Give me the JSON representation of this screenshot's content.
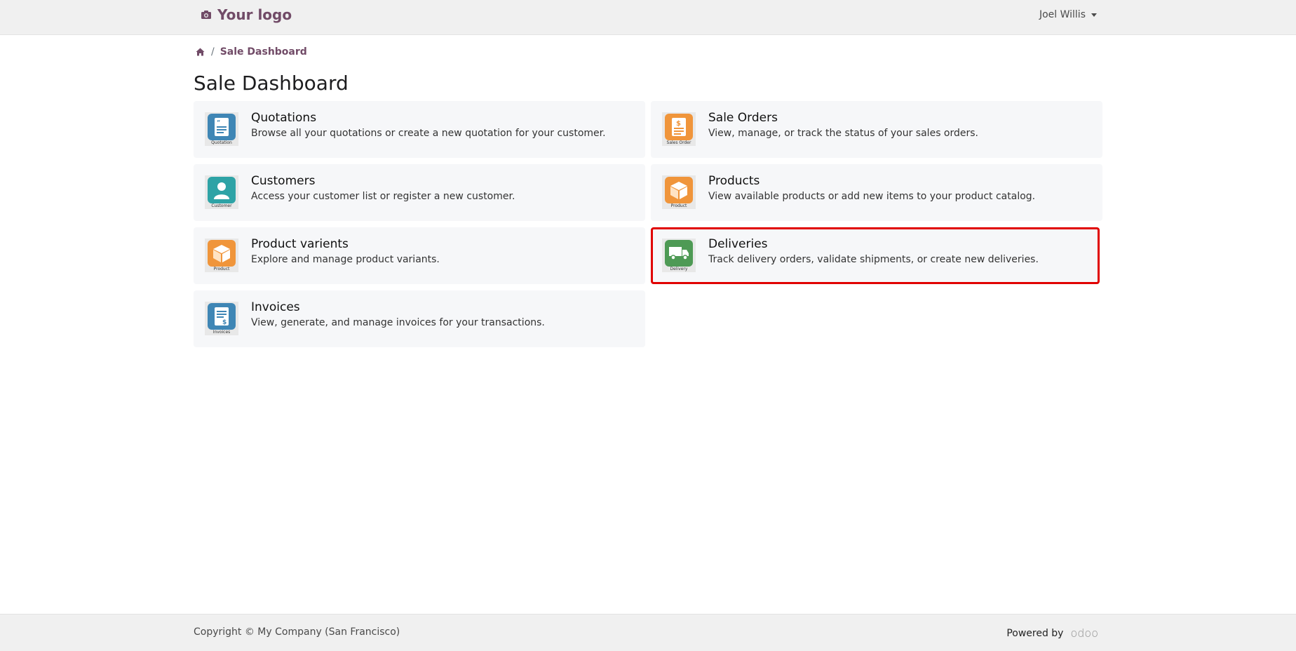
{
  "header": {
    "logo_text": "Your logo",
    "user_name": "Joel Willis"
  },
  "breadcrumb": {
    "current": "Sale Dashboard"
  },
  "page": {
    "title": "Sale Dashboard"
  },
  "cards": [
    {
      "title": "Quotations",
      "description": "Browse all your quotations or create a new quotation for your customer.",
      "caption": "Quotation",
      "icon": "quotation-icon",
      "color": "#3f86b5"
    },
    {
      "title": "Sale Orders",
      "description": "View, manage, or track the status of your sales orders.",
      "caption": "Sales Order",
      "icon": "sale-order-icon",
      "color": "#f0953b"
    },
    {
      "title": "Customers",
      "description": "Access your customer list or register a new customer.",
      "caption": "Customer",
      "icon": "customer-icon",
      "color": "#2ea3a6"
    },
    {
      "title": "Products",
      "description": "View available products or add new items to your product catalog.",
      "caption": "Product",
      "icon": "product-box-icon",
      "color": "#f0953b"
    },
    {
      "title": "Product varients",
      "description": "Explore and manage product variants.",
      "caption": "Product",
      "icon": "product-box-icon",
      "color": "#f0953b"
    },
    {
      "title": "Deliveries",
      "description": "Track delivery orders, validate shipments, or create new deliveries.",
      "caption": "Delivery",
      "icon": "delivery-truck-icon",
      "color": "#4e9a55",
      "highlighted": true
    },
    {
      "title": "Invoices",
      "description": "View, generate, and manage invoices for your transactions.",
      "caption": "Invoices",
      "icon": "invoice-icon",
      "color": "#3f86b5"
    }
  ],
  "footer": {
    "copyright": "Copyright © My Company (San Francisco)",
    "powered_by": "Powered by",
    "brand": "odoo"
  },
  "colors": {
    "accent": "#714b67",
    "highlight_border": "#e00000"
  }
}
